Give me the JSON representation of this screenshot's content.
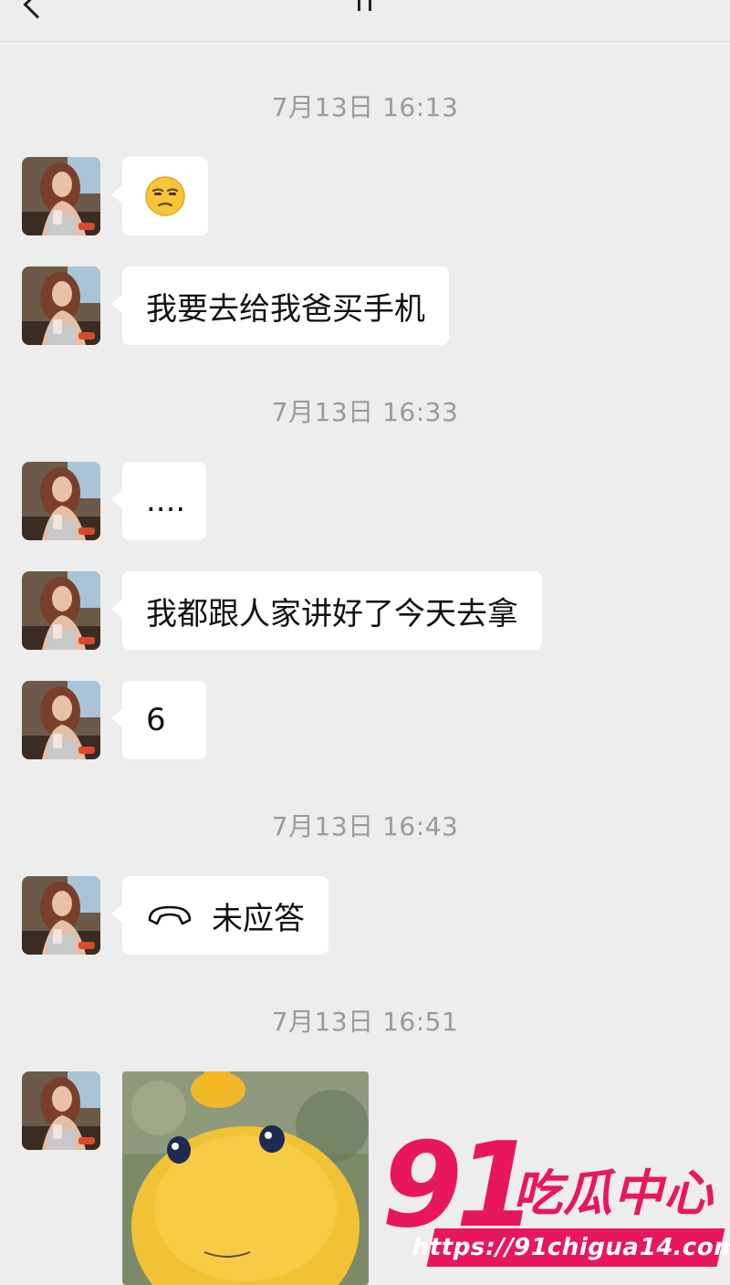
{
  "messages": [
    {
      "timestamp": "7月13日 16:13"
    },
    {
      "emoji": "😒"
    },
    {
      "text": "我要去给我爸买手机"
    },
    {
      "timestamp": "7月13日 16:33"
    },
    {
      "text": "...."
    },
    {
      "text": "我都跟人家讲好了今天去拿"
    },
    {
      "text": "6"
    },
    {
      "timestamp": "7月13日 16:43"
    },
    {
      "call_label": "未应答"
    },
    {
      "timestamp": "7月13日 16:51"
    }
  ],
  "watermark": {
    "number": "91",
    "name": "吃瓜中心",
    "url": "https://91chigua14.com"
  },
  "colors": {
    "background": "#ededed",
    "bubble": "#ffffff",
    "timestamp": "#9a9a9a",
    "watermark": "#e8175d"
  },
  "icons": {
    "back": "chevron-left-icon",
    "missed_call": "phone-hangup-icon"
  }
}
